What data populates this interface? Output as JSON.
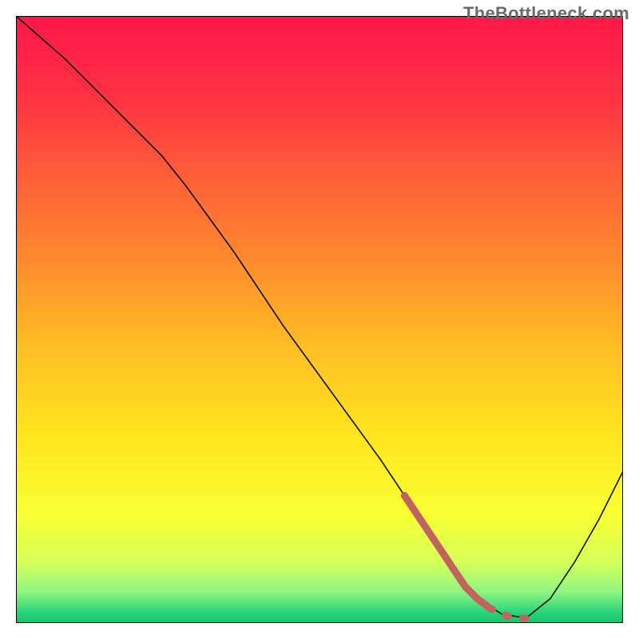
{
  "watermark": "TheBottleneck.com",
  "chart_data": {
    "type": "line",
    "title": "",
    "xlabel": "",
    "ylabel": "",
    "xlim": [
      0,
      100
    ],
    "ylim": [
      0,
      100
    ],
    "grid": false,
    "legend": false,
    "background": {
      "type": "vertical_gradient",
      "stops": [
        {
          "pos": 0.0,
          "color": "#ff184a"
        },
        {
          "pos": 0.12,
          "color": "#ff2e44"
        },
        {
          "pos": 0.25,
          "color": "#ff5a3a"
        },
        {
          "pos": 0.4,
          "color": "#ff8a2e"
        },
        {
          "pos": 0.55,
          "color": "#ffc024"
        },
        {
          "pos": 0.7,
          "color": "#ffe81e"
        },
        {
          "pos": 0.82,
          "color": "#f9ff33"
        },
        {
          "pos": 0.9,
          "color": "#d6ff5a"
        },
        {
          "pos": 0.95,
          "color": "#8cf582"
        },
        {
          "pos": 0.985,
          "color": "#22d27a"
        },
        {
          "pos": 1.0,
          "color": "#17c56f"
        }
      ]
    },
    "series": [
      {
        "name": "bottleneck-curve",
        "color": "#000000",
        "width": 1.5,
        "x": [
          0,
          8,
          16,
          24,
          28,
          36,
          44,
          52,
          60,
          64,
          68,
          72,
          76,
          80,
          84,
          88,
          92,
          96,
          100
        ],
        "values": [
          100,
          93,
          85,
          77,
          72,
          61,
          49,
          38,
          27,
          21,
          15,
          9,
          4,
          1.5,
          0.8,
          4,
          10,
          17,
          25
        ]
      }
    ],
    "markers": {
      "name": "highlighted-segment",
      "color": "#c1635f",
      "style": "thick_dashed",
      "x": [
        64,
        66,
        68,
        70,
        72,
        74,
        76,
        78,
        80,
        82,
        84
      ],
      "values": [
        21,
        18,
        15,
        12,
        9,
        6,
        4,
        2.5,
        1.5,
        0.8,
        0.8
      ]
    }
  }
}
